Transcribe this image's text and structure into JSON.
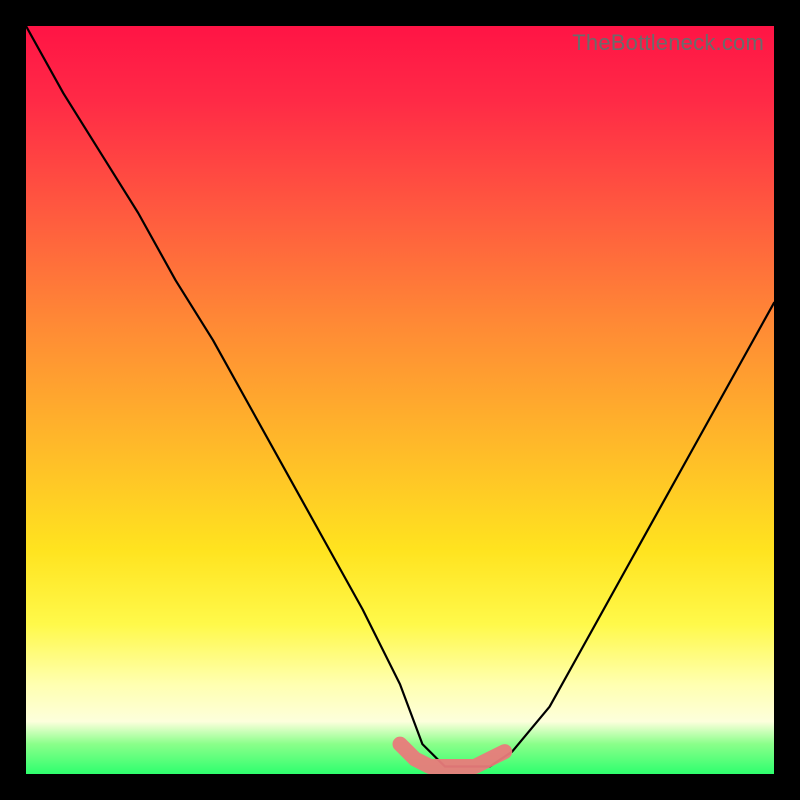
{
  "watermark": "TheBottleneck.com",
  "chart_data": {
    "type": "line",
    "title": "",
    "xlabel": "",
    "ylabel": "",
    "xlim": [
      0,
      100
    ],
    "ylim": [
      0,
      100
    ],
    "grid": false,
    "legend": false,
    "annotations": [],
    "series": [
      {
        "name": "black-curve",
        "color": "#000000",
        "x": [
          0,
          5,
          10,
          15,
          20,
          25,
          30,
          35,
          40,
          45,
          50,
          53,
          56,
          59,
          62,
          65,
          70,
          75,
          80,
          85,
          90,
          95,
          100
        ],
        "y": [
          100,
          91,
          83,
          75,
          66,
          58,
          49,
          40,
          31,
          22,
          12,
          4,
          1,
          1,
          1,
          3,
          9,
          18,
          27,
          36,
          45,
          54,
          63
        ]
      },
      {
        "name": "pink-trough-highlight",
        "color": "#e97b7b",
        "x": [
          50,
          52,
          54,
          56,
          58,
          60,
          62,
          64
        ],
        "y": [
          4,
          2,
          1,
          1,
          1,
          1,
          2,
          3
        ]
      }
    ],
    "gradient_stops": [
      {
        "pos": 0,
        "color": "#ff1445"
      },
      {
        "pos": 25,
        "color": "#ff5a3f"
      },
      {
        "pos": 55,
        "color": "#ffb62a"
      },
      {
        "pos": 80,
        "color": "#fff94a"
      },
      {
        "pos": 93,
        "color": "#fdffdc"
      },
      {
        "pos": 100,
        "color": "#2eff6e"
      }
    ]
  }
}
